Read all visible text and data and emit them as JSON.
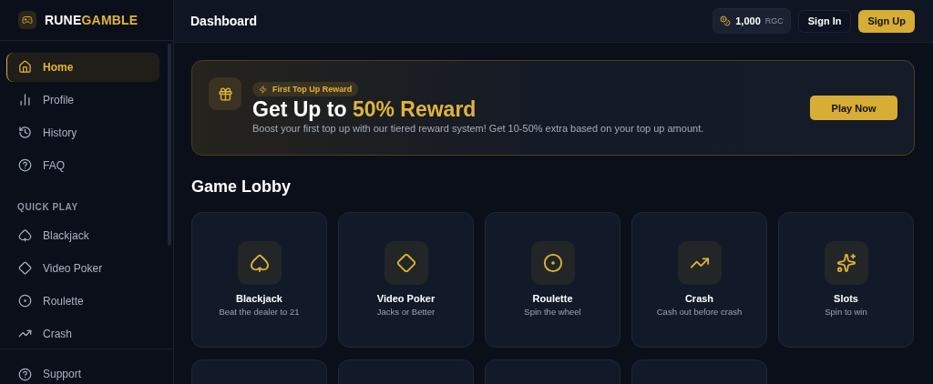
{
  "brand": {
    "part_1": "RUNE",
    "part_2": "GAMBLE"
  },
  "sidebar": {
    "items": [
      {
        "label": "Home",
        "selected": true
      },
      {
        "label": "Profile",
        "selected": false
      },
      {
        "label": "History",
        "selected": false
      },
      {
        "label": "FAQ",
        "selected": false
      }
    ],
    "section_title": "QUICK PLAY",
    "quick_play": [
      {
        "label": "Blackjack",
        "selected": false
      },
      {
        "label": "Video Poker",
        "selected": false
      },
      {
        "label": "Roulette",
        "selected": false
      },
      {
        "label": "Crash",
        "selected": false
      }
    ],
    "footer_item": {
      "label": "Support"
    }
  },
  "header": {
    "title": "Dashboard",
    "balance": "1,000",
    "currency": "RGC",
    "sign_in": "Sign In",
    "sign_up": "Sign Up"
  },
  "banner": {
    "badge": "First Top Up Reward",
    "title": "Get Up to **50% Reward**",
    "text": "Boost your first top up with our tiered reward system! Get 10-50% extra based on your top up amount.",
    "button": "Play Now"
  },
  "lobby": {
    "title": "Game Lobby",
    "games": [
      {
        "kind": "game",
        "name": "Blackjack",
        "subtitle": "Beat the dealer to 21"
      },
      {
        "kind": "game",
        "name": "Video Poker",
        "subtitle": "Jacks or Better"
      },
      {
        "kind": "game",
        "name": "Roulette",
        "subtitle": "Spin the wheel"
      },
      {
        "kind": "game",
        "name": "Crash",
        "subtitle": "Cash out before crash"
      },
      {
        "kind": "game",
        "name": "Slots",
        "subtitle": "Spin to win"
      },
      {
        "kind": "cut-off"
      },
      {
        "kind": "cut-off"
      },
      {
        "kind": "cut-off"
      },
      {
        "kind": "cut-off"
      }
    ]
  }
}
